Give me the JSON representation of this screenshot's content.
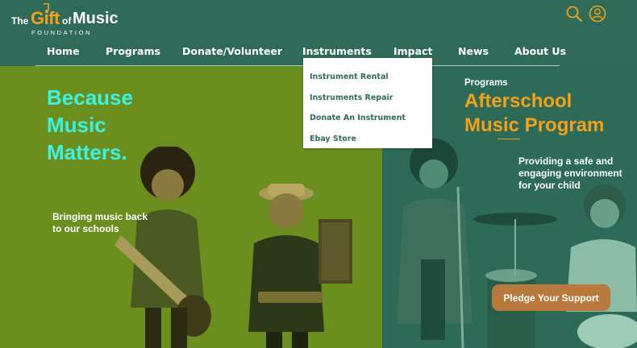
{
  "logo": {
    "the": "The",
    "gift": "Gift",
    "of": "of",
    "music": "Music",
    "foundation": "FOUNDATION"
  },
  "header": {
    "icons": [
      "search-icon",
      "user-icon"
    ]
  },
  "nav": {
    "items": [
      "Home",
      "Programs",
      "Donate/Volunteer",
      "Instruments",
      "Impact",
      "News",
      "About Us"
    ]
  },
  "dropdown": {
    "items": [
      "Instrument Rental",
      "Instruments Repair",
      "Donate An Instrument",
      "Ebay Store"
    ]
  },
  "hero_left": {
    "title_lines": [
      "Because",
      "Music",
      "Matters."
    ],
    "caption": "Bringing music back to our schools"
  },
  "hero_right": {
    "kicker": "Programs",
    "title_lines": [
      "Afterschool",
      "Music Program"
    ],
    "caption": "Providing a safe and engaging environment for your child",
    "button": "Pledge Your Support"
  },
  "colors": {
    "header_bg": "#2f6b58",
    "accent_orange": "#f2a11a",
    "accent_cyan": "#3ef2e0",
    "left_panel": "#6a8f1f",
    "right_panel": "#2d6a57",
    "button": "#b9793d"
  }
}
